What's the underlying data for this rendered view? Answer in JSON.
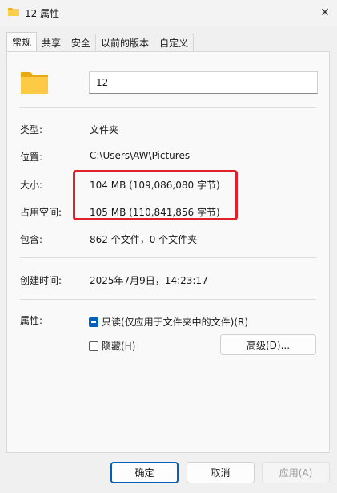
{
  "window": {
    "title": "12 属性",
    "close": "✕"
  },
  "tabs": [
    "常规",
    "共享",
    "安全",
    "以前的版本",
    "自定义"
  ],
  "general": {
    "name_value": "12",
    "rows": {
      "type": {
        "label": "类型:",
        "value": "文件夹"
      },
      "location": {
        "label": "位置:",
        "value": "C:\\Users\\AW\\Pictures"
      },
      "size": {
        "label": "大小:",
        "value": "104 MB (109,086,080 字节)"
      },
      "size_on_disk": {
        "label": "占用空间:",
        "value": "105 MB (110,841,856 字节)"
      },
      "contains": {
        "label": "包含:",
        "value": "862 个文件，0 个文件夹"
      },
      "created": {
        "label": "创建时间:",
        "value": "2025年7月9日，14:23:17"
      }
    },
    "attributes": {
      "label": "属性:",
      "readonly": "只读(仅应用于文件夹中的文件)(R)",
      "hidden": "隐藏(H)",
      "advanced": "高级(D)..."
    }
  },
  "buttons": {
    "ok": "确定",
    "cancel": "取消",
    "apply": "应用(A)"
  },
  "colors": {
    "accent": "#005fb8",
    "highlight": "#e0212a",
    "folder": "#f7c948"
  }
}
